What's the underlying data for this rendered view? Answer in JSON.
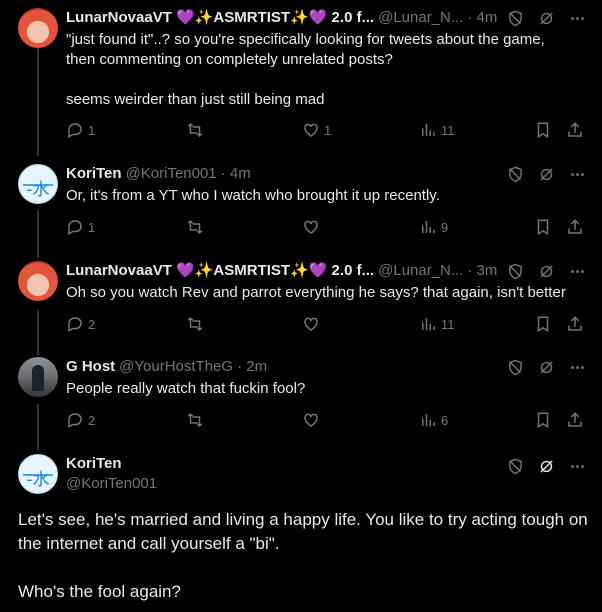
{
  "tweets": [
    {
      "name": "LunarNovaaVT 💜✨ASMRTIST✨💜 2.0 f...",
      "handle": "@Lunar_N...",
      "time": "· 4m",
      "text": "\"just found it\"..? so you're specifically looking for tweets about the game, then commenting on completely unrelated posts?\n\nseems weirder than just still being mad",
      "replies": "1",
      "reposts": "",
      "likes": "1",
      "views": "11"
    },
    {
      "name": "KoriTen",
      "handle": "@KoriTen001",
      "time": "· 4m",
      "text": "Or, it's from a YT who I watch who brought it up recently.",
      "replies": "1",
      "reposts": "",
      "likes": "",
      "views": "9"
    },
    {
      "name": "LunarNovaaVT 💜✨ASMRTIST✨💜 2.0 f...",
      "handle": "@Lunar_N...",
      "time": "· 3m",
      "text": "Oh so you watch Rev and parrot everything he says? that again, isn't better",
      "replies": "2",
      "reposts": "",
      "likes": "",
      "views": "11"
    },
    {
      "name": "G Host",
      "handle": "@YourHostTheG",
      "time": "· 2m",
      "text": "People really watch that fuckin fool?",
      "replies": "2",
      "reposts": "",
      "likes": "",
      "views": "6"
    }
  ],
  "main_tweet": {
    "name": "KoriTen",
    "handle": "@KoriTen001",
    "text": "Let's see, he's married and living a happy life. You like to try acting tough on the internet and call yourself a \"bi\".\n\nWho's the fool again?"
  },
  "avatar_kori_glyph": "-水卜",
  "more_glyph": "···"
}
